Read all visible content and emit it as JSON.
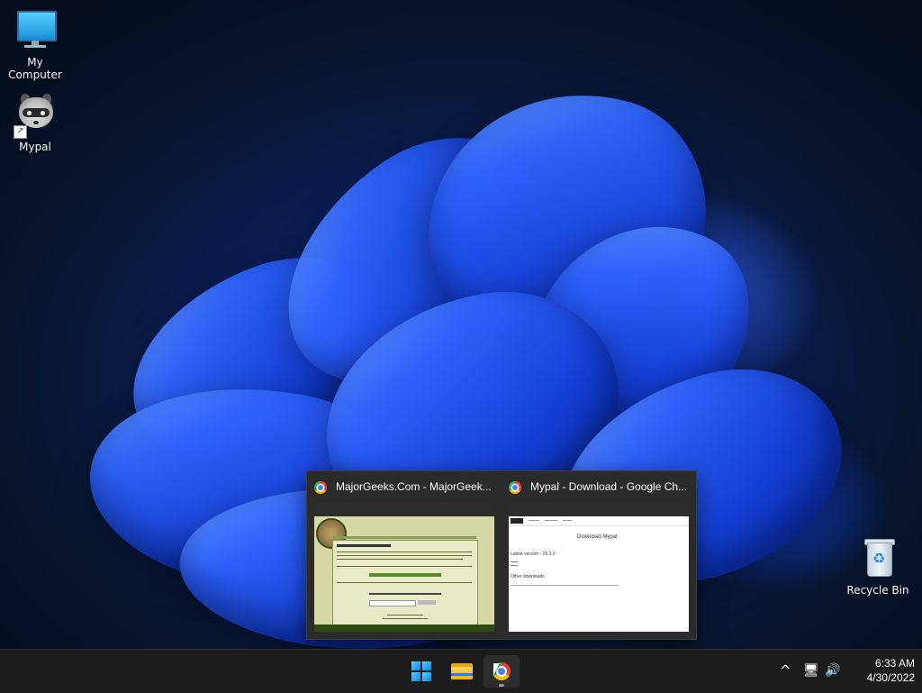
{
  "desktop": {
    "icons": [
      {
        "label": "My Computer",
        "icon": "monitor-icon"
      },
      {
        "label": "Mypal",
        "icon": "raccoon-icon"
      },
      {
        "label": "Recycle Bin",
        "icon": "recycle-bin-icon"
      }
    ]
  },
  "preview": {
    "windows": [
      {
        "title": "MajorGeeks.Com - MajorGeek...",
        "icon": "chrome-icon"
      },
      {
        "title": "Mypal - Download - Google Ch...",
        "icon": "chrome-icon"
      }
    ],
    "mypal_page": {
      "heading": "Download Mypal",
      "latest": "Latest version - 29.3.0",
      "other": "Other downloads"
    }
  },
  "taskbar": {
    "buttons": [
      {
        "name": "start",
        "icon": "windows-start-icon"
      },
      {
        "name": "file-explorer",
        "icon": "folder-icon"
      },
      {
        "name": "chrome",
        "icon": "chrome-icon"
      }
    ],
    "tray": {
      "overflow": "^",
      "network": "🖥",
      "volume": "🔊"
    },
    "clock": {
      "time": "6:33 AM",
      "date": "4/30/2022"
    }
  },
  "colors": {
    "taskbar_bg": "#1c1c1c",
    "accent": "#0a84e8",
    "wallpaper_blue": "#1440d8"
  }
}
